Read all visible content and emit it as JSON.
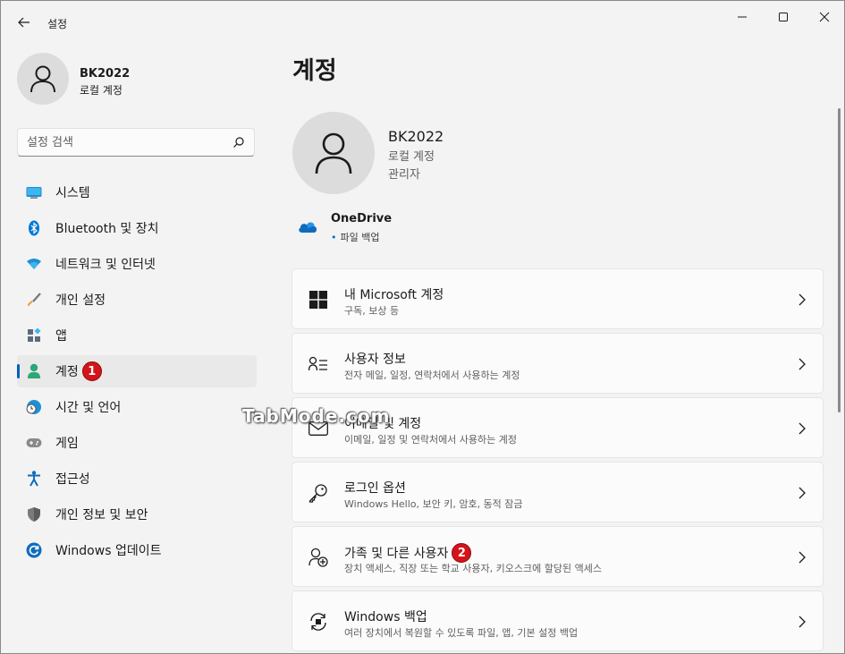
{
  "window": {
    "title": "설정"
  },
  "profile": {
    "name": "BK2022",
    "subtitle": "로컬 계정"
  },
  "search": {
    "placeholder": "설정 검색"
  },
  "nav": {
    "items": [
      {
        "label": "시스템",
        "icon": "system-icon"
      },
      {
        "label": "Bluetooth 및 장치",
        "icon": "bluetooth-icon"
      },
      {
        "label": "네트워크 및 인터넷",
        "icon": "wifi-icon"
      },
      {
        "label": "개인 설정",
        "icon": "brush-icon"
      },
      {
        "label": "앱",
        "icon": "apps-icon"
      },
      {
        "label": "계정",
        "icon": "account-icon",
        "active": true,
        "badge": "1"
      },
      {
        "label": "시간 및 언어",
        "icon": "clock-globe-icon"
      },
      {
        "label": "게임",
        "icon": "gamepad-icon"
      },
      {
        "label": "접근성",
        "icon": "accessibility-icon"
      },
      {
        "label": "개인 정보 및 보안",
        "icon": "shield-icon"
      },
      {
        "label": "Windows 업데이트",
        "icon": "update-icon"
      }
    ]
  },
  "main": {
    "title": "계정",
    "user": {
      "name": "BK2022",
      "type": "로컬 계정",
      "role": "관리자"
    },
    "onedrive": {
      "title": "OneDrive",
      "status": "파일 백업"
    },
    "cards": [
      {
        "title": "내 Microsoft 계정",
        "desc": "구독, 보상 등",
        "icon": "windows-logo-icon"
      },
      {
        "title": "사용자 정보",
        "desc": "전자 메일, 일정, 연락처에서 사용하는 계정",
        "icon": "user-info-icon"
      },
      {
        "title": "이메일 및 계정",
        "desc": "이메일, 일정 및 연락처에서 사용하는 계정",
        "icon": "mail-icon"
      },
      {
        "title": "로그인 옵션",
        "desc": "Windows Hello, 보안 키, 암호, 동적 잠금",
        "icon": "key-icon"
      },
      {
        "title": "가족 및 다른 사용자",
        "desc": "장치 액세스, 직장 또는 학교 사용자, 키오스크에 할당된 액세스",
        "icon": "add-user-icon",
        "badge": "2"
      },
      {
        "title": "Windows 백업",
        "desc": "여러 장치에서 복원할 수 있도록 파일, 앱, 기본 설정 백업",
        "icon": "backup-icon"
      }
    ]
  },
  "watermark": "TabMode.com",
  "colors": {
    "accent": "#005fb8",
    "badge": "#d4141a",
    "background": "#f3f3f3",
    "card": "#fbfbfb"
  }
}
